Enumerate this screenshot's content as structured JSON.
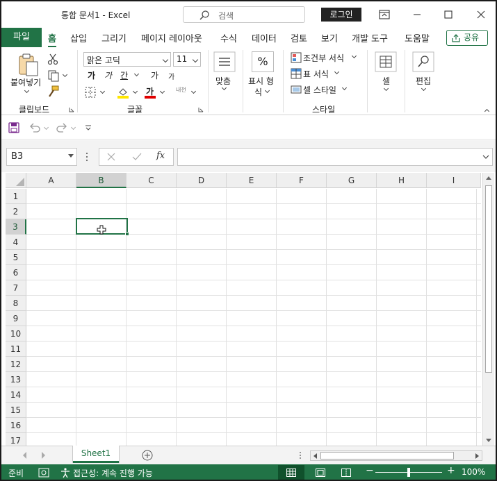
{
  "window": {
    "title": "통합 문서1  -  Excel",
    "search_placeholder": "검색",
    "login_label": "로그인"
  },
  "tabs": {
    "file": "파일",
    "items": [
      "홈",
      "삽입",
      "그리기",
      "페이지 레이아웃",
      "수식",
      "데이터",
      "검토",
      "보기",
      "개발 도구",
      "도움말"
    ],
    "active": "홈",
    "share_label": "공유"
  },
  "ribbon": {
    "clipboard": {
      "paste_label": "붙여넣기",
      "group_label": "클립보드"
    },
    "font": {
      "font_name": "맑은 고딕",
      "font_size": "11",
      "bold": "가",
      "italic": "가",
      "underline": "간",
      "grow": "가",
      "shrink": "가",
      "font_color_glyph": "가",
      "phonetic": "내천",
      "group_label": "글꼴"
    },
    "alignment": {
      "label": "맞춤"
    },
    "number": {
      "label_line1": "표시 형",
      "label_line2": "식",
      "glyph": "%"
    },
    "styles": {
      "conditional": "조건부 서식",
      "table": "표 서식",
      "cell_styles": "셀 스타일",
      "group_label": "스타일"
    },
    "cells": {
      "label": "셀"
    },
    "editing": {
      "label": "편집"
    }
  },
  "formula_bar": {
    "name_box": "B3",
    "fx": "fx",
    "formula": ""
  },
  "sheet": {
    "columns": [
      "A",
      "B",
      "C",
      "D",
      "E",
      "F",
      "G",
      "H",
      "I"
    ],
    "rows": [
      "1",
      "2",
      "3",
      "4",
      "5",
      "6",
      "7",
      "8",
      "9",
      "10",
      "11",
      "12",
      "13",
      "14",
      "15",
      "16",
      "17"
    ],
    "selected_column": "B",
    "selected_row": "3"
  },
  "sheet_tabs": {
    "tabs": [
      "Sheet1"
    ],
    "active": "Sheet1"
  },
  "status_bar": {
    "ready": "준비",
    "accessibility": "접근성: 계속 진행 가능",
    "zoom": "100%"
  },
  "colors": {
    "accent": "#217346"
  }
}
